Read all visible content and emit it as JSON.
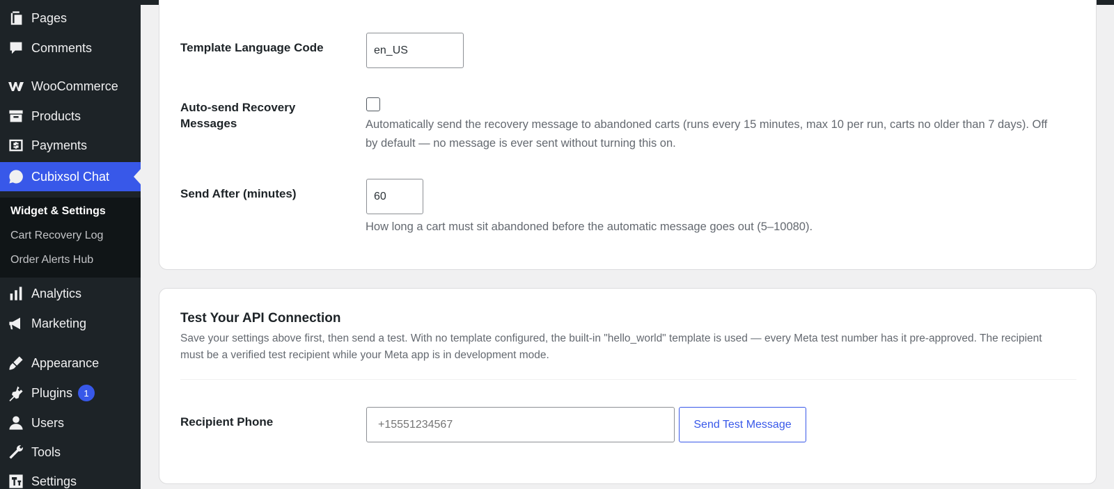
{
  "sidebar": {
    "items": [
      {
        "label": "Pages",
        "icon": "pages-icon"
      },
      {
        "label": "Comments",
        "icon": "comments-icon"
      },
      {
        "label": "WooCommerce",
        "icon": "woocommerce-icon"
      },
      {
        "label": "Products",
        "icon": "products-icon"
      },
      {
        "label": "Payments",
        "icon": "payments-icon"
      },
      {
        "label": "Cubixsol Chat",
        "icon": "chat-icon"
      },
      {
        "label": "Analytics",
        "icon": "analytics-icon"
      },
      {
        "label": "Marketing",
        "icon": "marketing-icon"
      },
      {
        "label": "Appearance",
        "icon": "appearance-icon"
      },
      {
        "label": "Plugins",
        "icon": "plugins-icon",
        "badge": "1"
      },
      {
        "label": "Users",
        "icon": "users-icon"
      },
      {
        "label": "Tools",
        "icon": "tools-icon"
      },
      {
        "label": "Settings",
        "icon": "settings-icon"
      }
    ],
    "submenu": [
      "Widget & Settings",
      "Cart Recovery Log",
      "Order Alerts Hub"
    ]
  },
  "settings": {
    "template_lang_label": "Template Language Code",
    "template_lang_value": "en_US",
    "autosend_label": "Auto-send Recovery Messages",
    "autosend_checked": false,
    "autosend_desc": "Automatically send the recovery message to abandoned carts (runs every 15 minutes, max 10 per run, carts no older than 7 days). Off by default — no message is ever sent without turning this on.",
    "send_after_label": "Send After (minutes)",
    "send_after_value": "60",
    "send_after_desc": "How long a cart must sit abandoned before the automatic message goes out (5–10080)."
  },
  "api_test": {
    "title": "Test Your API Connection",
    "desc": "Save your settings above first, then send a test. With no template configured, the built-in \"hello_world\" template is used — every Meta test number has it pre-approved. The recipient must be a verified test recipient while your Meta app is in development mode.",
    "phone_label": "Recipient Phone",
    "phone_placeholder": "+15551234567",
    "send_button": "Send Test Message"
  },
  "colors": {
    "sidebar_bg": "#1d2327",
    "accent": "#3858e9",
    "submenu_bg": "#101517"
  }
}
